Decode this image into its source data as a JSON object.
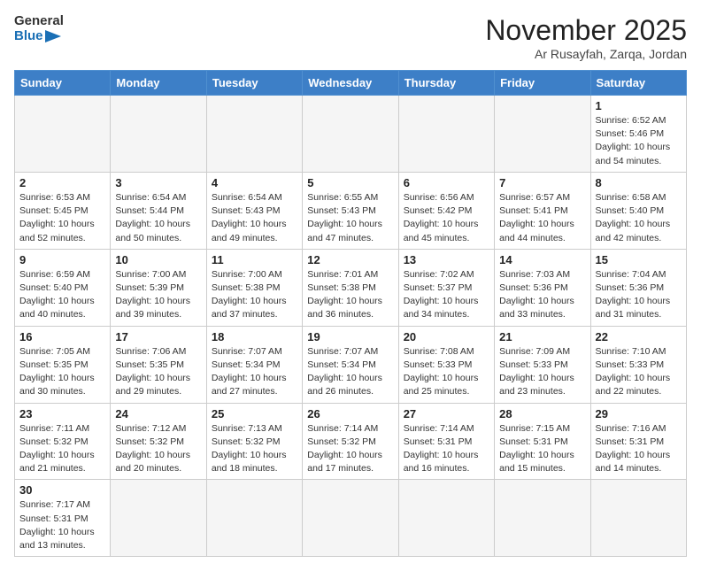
{
  "header": {
    "logo_general": "General",
    "logo_blue": "Blue",
    "month_title": "November 2025",
    "subtitle": "Ar Rusayfah, Zarqa, Jordan"
  },
  "weekdays": [
    "Sunday",
    "Monday",
    "Tuesday",
    "Wednesday",
    "Thursday",
    "Friday",
    "Saturday"
  ],
  "weeks": [
    [
      {
        "day": "",
        "info": ""
      },
      {
        "day": "",
        "info": ""
      },
      {
        "day": "",
        "info": ""
      },
      {
        "day": "",
        "info": ""
      },
      {
        "day": "",
        "info": ""
      },
      {
        "day": "",
        "info": ""
      },
      {
        "day": "1",
        "info": "Sunrise: 6:52 AM\nSunset: 5:46 PM\nDaylight: 10 hours\nand 54 minutes."
      }
    ],
    [
      {
        "day": "2",
        "info": "Sunrise: 6:53 AM\nSunset: 5:45 PM\nDaylight: 10 hours\nand 52 minutes."
      },
      {
        "day": "3",
        "info": "Sunrise: 6:54 AM\nSunset: 5:44 PM\nDaylight: 10 hours\nand 50 minutes."
      },
      {
        "day": "4",
        "info": "Sunrise: 6:54 AM\nSunset: 5:43 PM\nDaylight: 10 hours\nand 49 minutes."
      },
      {
        "day": "5",
        "info": "Sunrise: 6:55 AM\nSunset: 5:43 PM\nDaylight: 10 hours\nand 47 minutes."
      },
      {
        "day": "6",
        "info": "Sunrise: 6:56 AM\nSunset: 5:42 PM\nDaylight: 10 hours\nand 45 minutes."
      },
      {
        "day": "7",
        "info": "Sunrise: 6:57 AM\nSunset: 5:41 PM\nDaylight: 10 hours\nand 44 minutes."
      },
      {
        "day": "8",
        "info": "Sunrise: 6:58 AM\nSunset: 5:40 PM\nDaylight: 10 hours\nand 42 minutes."
      }
    ],
    [
      {
        "day": "9",
        "info": "Sunrise: 6:59 AM\nSunset: 5:40 PM\nDaylight: 10 hours\nand 40 minutes."
      },
      {
        "day": "10",
        "info": "Sunrise: 7:00 AM\nSunset: 5:39 PM\nDaylight: 10 hours\nand 39 minutes."
      },
      {
        "day": "11",
        "info": "Sunrise: 7:00 AM\nSunset: 5:38 PM\nDaylight: 10 hours\nand 37 minutes."
      },
      {
        "day": "12",
        "info": "Sunrise: 7:01 AM\nSunset: 5:38 PM\nDaylight: 10 hours\nand 36 minutes."
      },
      {
        "day": "13",
        "info": "Sunrise: 7:02 AM\nSunset: 5:37 PM\nDaylight: 10 hours\nand 34 minutes."
      },
      {
        "day": "14",
        "info": "Sunrise: 7:03 AM\nSunset: 5:36 PM\nDaylight: 10 hours\nand 33 minutes."
      },
      {
        "day": "15",
        "info": "Sunrise: 7:04 AM\nSunset: 5:36 PM\nDaylight: 10 hours\nand 31 minutes."
      }
    ],
    [
      {
        "day": "16",
        "info": "Sunrise: 7:05 AM\nSunset: 5:35 PM\nDaylight: 10 hours\nand 30 minutes."
      },
      {
        "day": "17",
        "info": "Sunrise: 7:06 AM\nSunset: 5:35 PM\nDaylight: 10 hours\nand 29 minutes."
      },
      {
        "day": "18",
        "info": "Sunrise: 7:07 AM\nSunset: 5:34 PM\nDaylight: 10 hours\nand 27 minutes."
      },
      {
        "day": "19",
        "info": "Sunrise: 7:07 AM\nSunset: 5:34 PM\nDaylight: 10 hours\nand 26 minutes."
      },
      {
        "day": "20",
        "info": "Sunrise: 7:08 AM\nSunset: 5:33 PM\nDaylight: 10 hours\nand 25 minutes."
      },
      {
        "day": "21",
        "info": "Sunrise: 7:09 AM\nSunset: 5:33 PM\nDaylight: 10 hours\nand 23 minutes."
      },
      {
        "day": "22",
        "info": "Sunrise: 7:10 AM\nSunset: 5:33 PM\nDaylight: 10 hours\nand 22 minutes."
      }
    ],
    [
      {
        "day": "23",
        "info": "Sunrise: 7:11 AM\nSunset: 5:32 PM\nDaylight: 10 hours\nand 21 minutes."
      },
      {
        "day": "24",
        "info": "Sunrise: 7:12 AM\nSunset: 5:32 PM\nDaylight: 10 hours\nand 20 minutes."
      },
      {
        "day": "25",
        "info": "Sunrise: 7:13 AM\nSunset: 5:32 PM\nDaylight: 10 hours\nand 18 minutes."
      },
      {
        "day": "26",
        "info": "Sunrise: 7:14 AM\nSunset: 5:32 PM\nDaylight: 10 hours\nand 17 minutes."
      },
      {
        "day": "27",
        "info": "Sunrise: 7:14 AM\nSunset: 5:31 PM\nDaylight: 10 hours\nand 16 minutes."
      },
      {
        "day": "28",
        "info": "Sunrise: 7:15 AM\nSunset: 5:31 PM\nDaylight: 10 hours\nand 15 minutes."
      },
      {
        "day": "29",
        "info": "Sunrise: 7:16 AM\nSunset: 5:31 PM\nDaylight: 10 hours\nand 14 minutes."
      }
    ],
    [
      {
        "day": "30",
        "info": "Sunrise: 7:17 AM\nSunset: 5:31 PM\nDaylight: 10 hours\nand 13 minutes."
      },
      {
        "day": "",
        "info": ""
      },
      {
        "day": "",
        "info": ""
      },
      {
        "day": "",
        "info": ""
      },
      {
        "day": "",
        "info": ""
      },
      {
        "day": "",
        "info": ""
      },
      {
        "day": "",
        "info": ""
      }
    ]
  ]
}
